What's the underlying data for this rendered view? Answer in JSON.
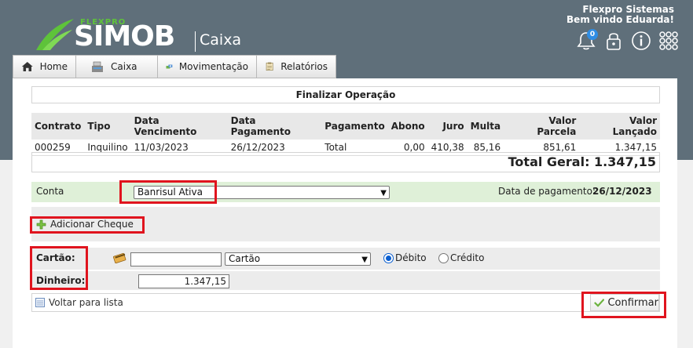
{
  "brand": {
    "small": "FLEXPRO",
    "big": "SIMOB",
    "module": "Caixa"
  },
  "user": {
    "company": "Flexpro Sistemas",
    "welcome": "Bem vindo Eduarda!"
  },
  "header_icons": {
    "notifications_badge": "0",
    "icons": [
      "bell-icon",
      "lock-icon",
      "info-icon",
      "apps-grid-icon"
    ]
  },
  "menu": [
    {
      "label": "Home",
      "icon": "home-icon"
    },
    {
      "label": "Caixa",
      "icon": "cash-register-icon"
    },
    {
      "label": "Movimentação",
      "icon": "money-transfer-icon"
    },
    {
      "label": "Relatórios",
      "icon": "report-icon"
    }
  ],
  "operation": {
    "title": "Finalizar Operação",
    "columns": [
      "Contrato",
      "Tipo",
      "Data Vencimento",
      "Data Pagamento",
      "Pagamento",
      "Abono",
      "Juro",
      "Multa",
      "Valor Parcela",
      "Valor Lançado"
    ],
    "rows": [
      [
        "000259",
        "Inquilino",
        "11/03/2023",
        "26/12/2023",
        "Total",
        "0,00",
        "410,38",
        "85,16",
        "851,61",
        "1.347,15"
      ]
    ],
    "total": "Total Geral: 1.347,15"
  },
  "conta": {
    "label": "Conta",
    "selected": "Banrisul Ativa",
    "date_label": "Data de pagamento:",
    "date_value": "26/12/2023"
  },
  "cheque": {
    "button_label": "Adicionar Cheque"
  },
  "cartao": {
    "label": "Cartão:",
    "input_value": "",
    "select_value": "Cartão",
    "radio_debito": "Débito",
    "radio_credito": "Crédito",
    "selected_radio": "Débito"
  },
  "dinheiro": {
    "label": "Dinheiro:",
    "value": "1.347,15"
  },
  "footer": {
    "back_label": "Voltar para lista",
    "confirm_label": "Confirmar"
  },
  "colors": {
    "header_bg": "#5f6f7a",
    "brand_green": "#5ec33a",
    "highlight": "#e0141e",
    "conta_bg": "#dff0d8"
  }
}
